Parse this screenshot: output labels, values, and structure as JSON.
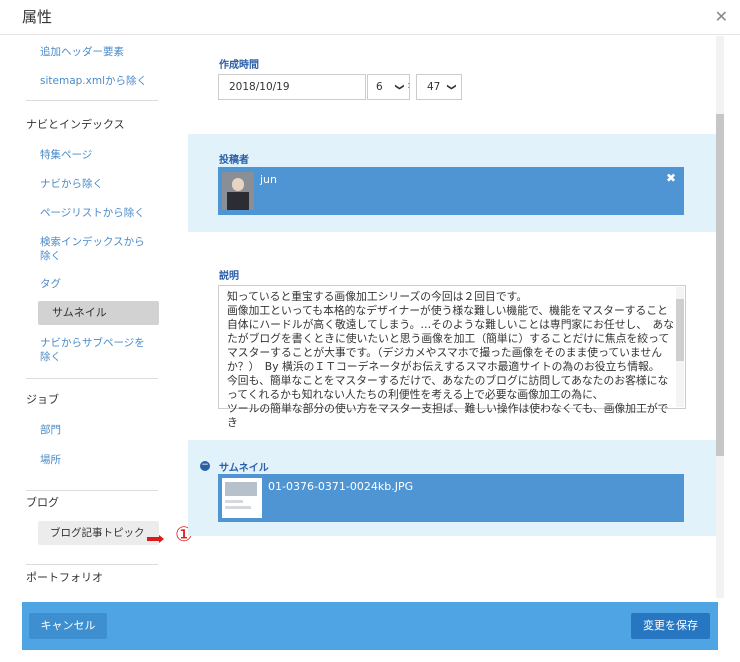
{
  "dialog": {
    "title": "属性"
  },
  "nav": {
    "items_top": [
      "追加ヘッダー要素",
      "sitemap.xmlから除く"
    ],
    "section1": "ナビとインデックス",
    "items1": [
      "特集ページ",
      "ナビから除く",
      "ページリストから除く",
      "検索インデックスから",
      "除く",
      "タグ"
    ],
    "active": "サムネイル",
    "item_after_active_1": "ナビからサブページを",
    "item_after_active_2": "除く",
    "section2": "ジョブ",
    "items2": [
      "部門",
      "場所"
    ],
    "section3": "ブログ",
    "blog_btn": "ブログ記事トピック",
    "annotation": "①",
    "section4": "ポートフォリオ"
  },
  "created": {
    "label": "作成時間",
    "date": "2018/10/19",
    "hour": "6",
    "minute": "47",
    "colon": ":"
  },
  "author": {
    "label": "投稿者",
    "name": "jun"
  },
  "description": {
    "label": "説明",
    "text": "知っていると重宝する画像加工シリーズの今回は２回目です。\n画像加工といっても本格的なデザイナーが使う様な難しい機能で、機能をマスターすること自体にハードルが高く敬遠してしまう。…そのような難しいことは専門家にお任せし、　あなたがブログを書くときに使いたいと思う画像を加工（簡単に）することだけに焦点を絞ってマスターすることが大事です。（デジカメやスマホで撮った画像をそのまま使っていませんか？）　By 横浜のＩＴコーデネータがお伝えするスマホ最適サイトの為のお役立ち情報。\n今回も、簡単なことをマスターするだけで、あなたのブログに訪問してあなたのお客様になってくれるかも知れない人たちの利便性を考える上で必要な画像加工の為に、\nツールの簡単な部分の使い方をマスター支担ば、難しい操作は使わなくても、画像加工ができ"
  },
  "thumbnail": {
    "label": "サムネイル",
    "filename": "01-0376-0371-0024kb.JPG"
  },
  "footer": {
    "cancel": "キャンセル",
    "save": "変更を保存"
  },
  "colors": {
    "link": "#4a8bc9",
    "label": "#2b5fa8",
    "panel": "#e2f2fb",
    "select_box": "#4f95d3",
    "footer": "#4fa5e3",
    "annotation": "#e01818"
  },
  "icons": [
    "close-icon",
    "chevron-down-icon",
    "remove-icon",
    "minus-circle-icon",
    "pointer-hand-icon"
  ]
}
